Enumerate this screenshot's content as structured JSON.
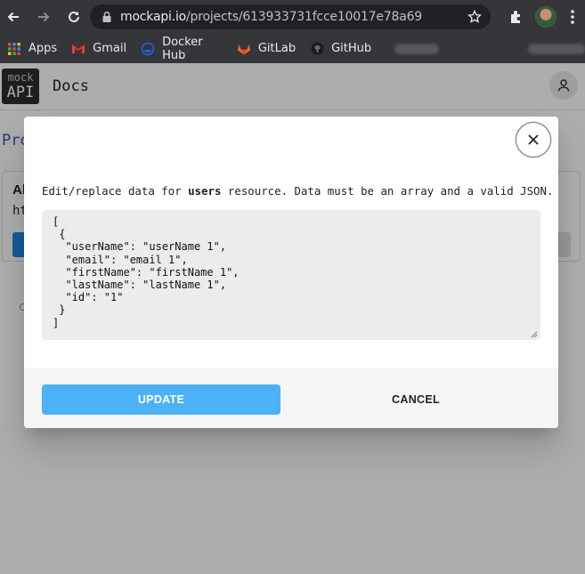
{
  "browser": {
    "url_domain": "mockapi.io",
    "url_path": "/projects/613933731fcce10017e78a69",
    "bookmarks": [
      {
        "label": "Apps",
        "icon": "apps-grid-icon"
      },
      {
        "label": "Gmail",
        "icon": "gmail-icon"
      },
      {
        "label": "Docker Hub",
        "icon": "docker-icon"
      },
      {
        "label": "GitLab",
        "icon": "gitlab-icon"
      },
      {
        "label": "GitHub",
        "icon": "github-icon"
      }
    ]
  },
  "app": {
    "logo_top": "mock",
    "logo_bottom": "API",
    "nav_docs": "Docs",
    "behind_title": "Pro",
    "behind_resource": "Al",
    "behind_url": "ht"
  },
  "dialog": {
    "desc_prefix": "Edit/replace data for ",
    "resource_name": "users",
    "desc_suffix": " resource. Data must be an array and a valid JSON.",
    "json_text": "[\n {\n  \"userName\": \"userName 1\",\n  \"email\": \"email 1\",\n  \"firstName\": \"firstName 1\",\n  \"lastName\": \"lastName 1\",\n  \"id\": \"1\"\n }\n]",
    "update_label": "UPDATE",
    "cancel_label": "CANCEL"
  },
  "colors": {
    "update_button": "#4db1f6",
    "chrome_bar": "#35363a",
    "editor_bg": "#ececec"
  }
}
